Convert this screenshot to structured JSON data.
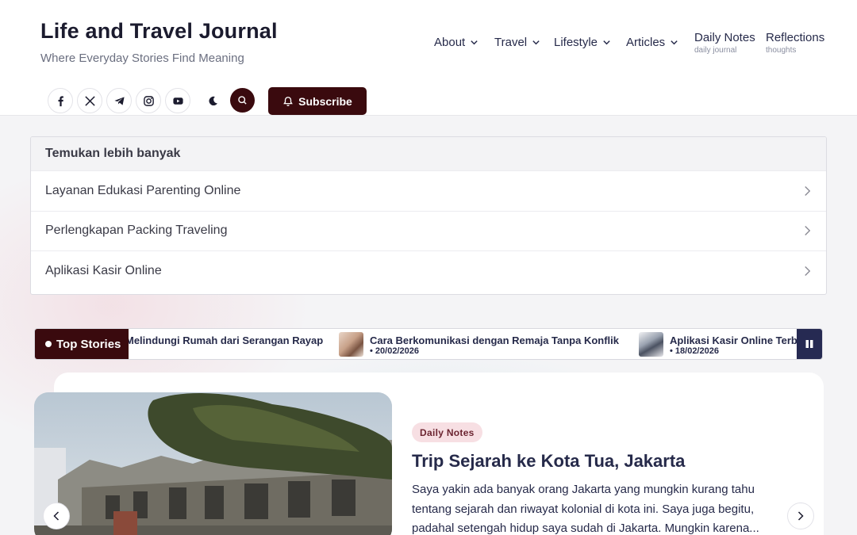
{
  "site": {
    "title": "Life and Travel Journal",
    "tagline": "Where Everyday Stories Find Meaning",
    "subscribe_label": "Subscribe"
  },
  "nav": {
    "items": [
      {
        "label": "About",
        "icon": "chevron-down-icon"
      },
      {
        "label": "Travel",
        "icon": "chevron-down-icon"
      },
      {
        "label": "Lifestyle",
        "icon": "chevron-down-icon"
      },
      {
        "label": "Articles",
        "icon": "chevron-down-icon"
      },
      {
        "label": "Daily Notes",
        "sublabel": "daily journal"
      },
      {
        "label": "Reflections",
        "sublabel": "thoughts"
      }
    ]
  },
  "social": [
    "facebook-icon",
    "x-icon",
    "telegram-icon",
    "instagram-icon",
    "youtube-icon",
    "moon-icon",
    "search-icon"
  ],
  "discover": {
    "heading": "Temukan lebih banyak",
    "items": [
      "Layanan Edukasi Parenting Online",
      "Perlengkapan Packing Traveling",
      "Aplikasi Kasir Online"
    ]
  },
  "ticker": {
    "label": "Top Stories",
    "items": [
      {
        "title": "Melindungi Rumah dari Serangan Rayap",
        "date": ""
      },
      {
        "title": "Cara Berkomunikasi dengan Remaja Tanpa Konflik",
        "date": "• 20/02/2026"
      },
      {
        "title": "Aplikasi Kasir Online Terbaik",
        "date": "• 18/02/2026"
      }
    ]
  },
  "featured": {
    "category": "Daily Notes",
    "title": "Trip Sejarah ke Kota Tua, Jakarta",
    "excerpt": "Saya yakin ada banyak orang Jakarta yang mungkin kurang tahu tentang sejarah dan riwayat kolonial di kota ini. Saya juga begitu, padahal setengah hidup saya sudah di Jakarta. Mungkin karena..."
  },
  "colors": {
    "brand_dark": "#3a0a0e",
    "text_navy": "#262a4a",
    "badge_bg": "#f7dfe3",
    "pause_bg": "#262a52"
  }
}
